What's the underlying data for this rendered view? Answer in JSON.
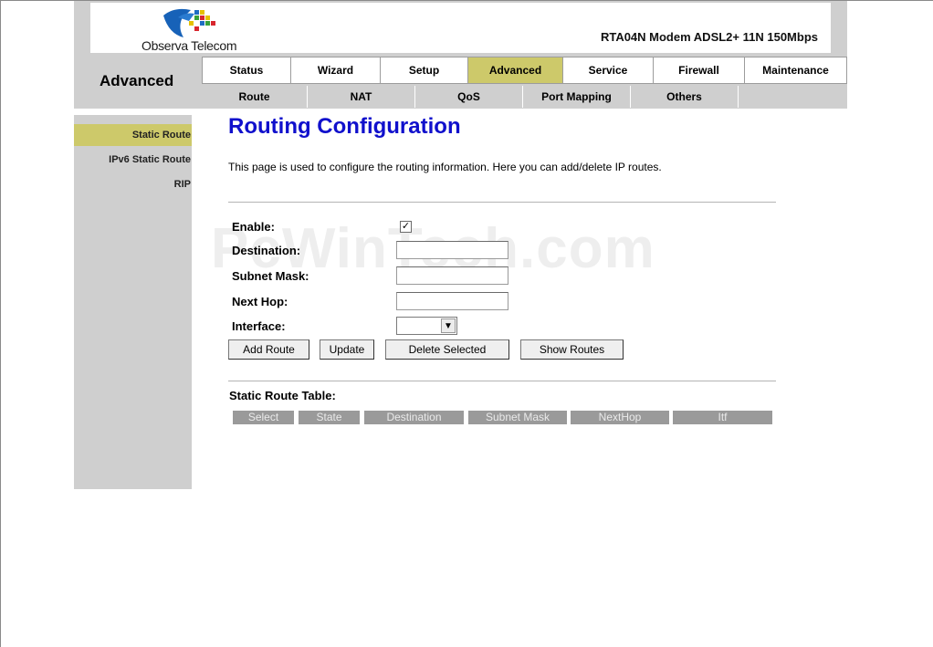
{
  "brand": {
    "name": "Observa Telecom",
    "model": "RTA04N Modem ADSL2+ 11N 150Mbps"
  },
  "section": "Advanced",
  "main_tabs": [
    "Status",
    "Wizard",
    "Setup",
    "Advanced",
    "Service",
    "Firewall",
    "Maintenance"
  ],
  "sub_tabs": [
    "Route",
    "NAT",
    "QoS",
    "Port Mapping",
    "Others"
  ],
  "sidebar": [
    "Static Route",
    "IPv6 Static Route",
    "RIP"
  ],
  "page": {
    "title": "Routing Configuration",
    "description": "This page is used to configure the routing information. Here you can add/delete IP routes."
  },
  "form": {
    "enable_label": "Enable:",
    "enable_checked": true,
    "check_mark": "✓",
    "destination_label": "Destination:",
    "destination_value": "",
    "subnet_label": "Subnet Mask:",
    "subnet_value": "",
    "nexthop_label": "Next Hop:",
    "nexthop_value": "",
    "interface_label": "Interface:",
    "interface_value": ""
  },
  "buttons": {
    "add": "Add Route",
    "update": "Update",
    "delete": "Delete Selected",
    "show": "Show Routes"
  },
  "table": {
    "title": "Static Route Table:",
    "headers": [
      "Select",
      "State",
      "Destination",
      "Subnet Mask",
      "NextHop",
      "Itf"
    ]
  },
  "watermark": "PcWinTech.com",
  "colors": {
    "accent": "#cdc96a",
    "title_blue": "#1010cc",
    "panel_gray": "#cfcfcf",
    "table_header": "#9a9a9a"
  }
}
